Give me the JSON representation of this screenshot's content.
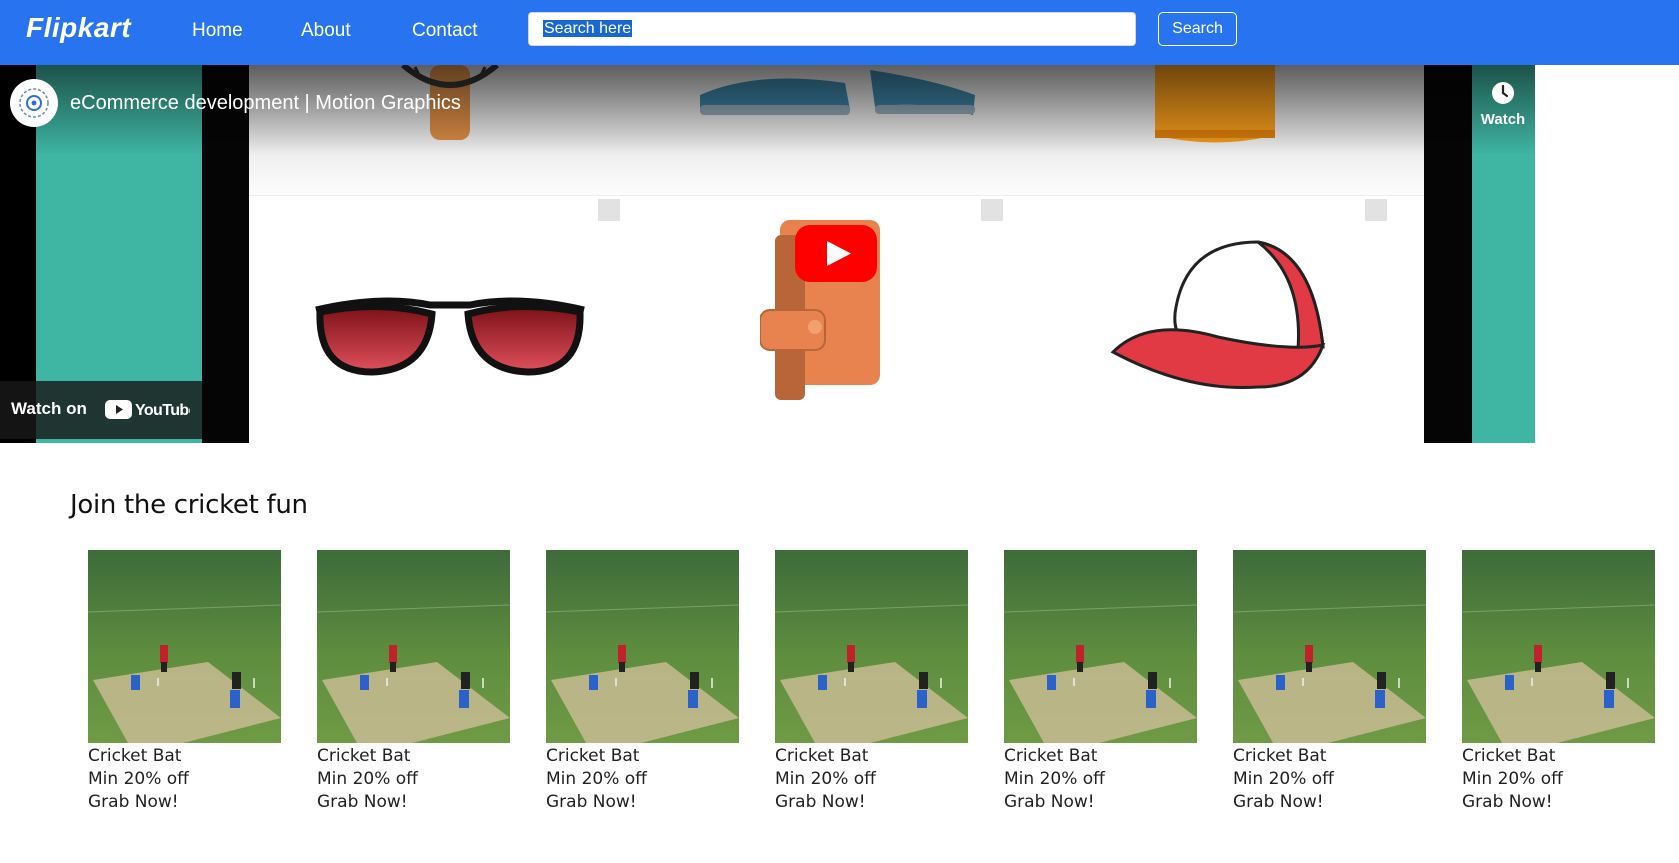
{
  "navbar": {
    "brand": "Flipkart",
    "links": [
      "Home",
      "About",
      "Contact"
    ],
    "search_value": "Search here",
    "search_button": "Search",
    "color": "#2874f0"
  },
  "video": {
    "title": "eCommerce development | Motion Graphics",
    "watch_later": "Watch",
    "watch_on": "Watch on",
    "youtube_logo": "YouTube"
  },
  "section": {
    "title": "Join the cricket fun"
  },
  "cards": [
    {
      "name": "Cricket Bat",
      "offer": "Min 20% off",
      "cta": "Grab Now!"
    },
    {
      "name": "Cricket Bat",
      "offer": "Min 20% off",
      "cta": "Grab Now!"
    },
    {
      "name": "Cricket Bat",
      "offer": "Min 20% off",
      "cta": "Grab Now!"
    },
    {
      "name": "Cricket Bat",
      "offer": "Min 20% off",
      "cta": "Grab Now!"
    },
    {
      "name": "Cricket Bat",
      "offer": "Min 20% off",
      "cta": "Grab Now!"
    },
    {
      "name": "Cricket Bat",
      "offer": "Min 20% off",
      "cta": "Grab Now!"
    },
    {
      "name": "Cricket Bat",
      "offer": "Min 20% off",
      "cta": "Grab Now!"
    }
  ]
}
